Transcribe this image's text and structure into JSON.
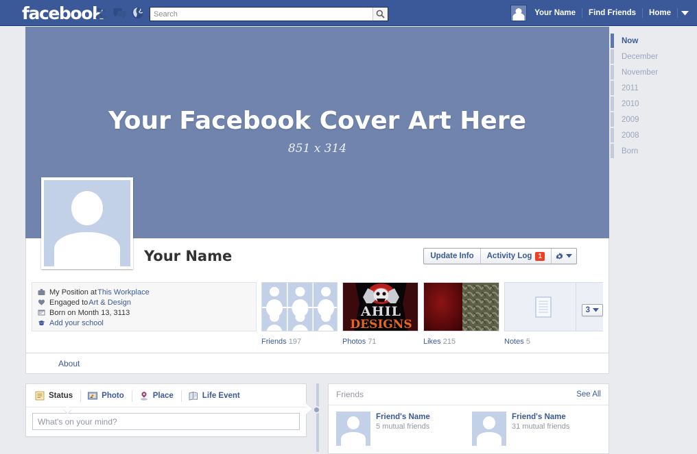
{
  "topbar": {
    "logo": "facebook",
    "icons": [
      {
        "name": "friend-requests-icon"
      },
      {
        "name": "messages-icon"
      },
      {
        "name": "notifications-globe-icon"
      }
    ],
    "search": {
      "placeholder": "Search",
      "value": "",
      "button_icon": "search-icon"
    },
    "right_links": [
      {
        "label": "Your Name",
        "name": "profile-link"
      },
      {
        "label": "Find Friends",
        "name": "find-friends-link"
      },
      {
        "label": "Home",
        "name": "home-link"
      }
    ],
    "caret_icon": "chevron-down-icon"
  },
  "rail": {
    "items": [
      {
        "label": "Now",
        "active": true
      },
      {
        "label": "December",
        "active": false
      },
      {
        "label": "November",
        "active": false
      },
      {
        "label": "2011",
        "active": false
      },
      {
        "label": "2010",
        "active": false
      },
      {
        "label": "2009",
        "active": false
      },
      {
        "label": "2008",
        "active": false
      },
      {
        "label": "Born",
        "active": false
      }
    ]
  },
  "cover": {
    "title": "Your Facebook Cover Art Here",
    "subtitle": "851 x 314",
    "color": "#7084ad"
  },
  "profile": {
    "name": "Your Name",
    "avatar_icon": "default-avatar-icon"
  },
  "actions": {
    "update_info": "Update Info",
    "activity_log": "Activity Log",
    "activity_badge": "1",
    "gear_icon": "gear-icon",
    "caret_icon": "chevron-down-icon"
  },
  "info": {
    "rows": [
      {
        "icon": "briefcase-icon",
        "text": "My Position at ",
        "link": "This Workplace"
      },
      {
        "icon": "heart-icon",
        "text": "Engaged to ",
        "link": "Art & Design"
      },
      {
        "icon": "calendar-icon",
        "text": "Born on Month   13, 3113",
        "link": ""
      },
      {
        "icon": "graduation-cap-icon",
        "text": "",
        "link": "Add your school"
      }
    ],
    "about_tab": "About"
  },
  "tiles": [
    {
      "label": "Friends",
      "count": "197",
      "kind": "friends"
    },
    {
      "label": "Photos",
      "count": "71",
      "kind": "photo-logo"
    },
    {
      "label": "Likes",
      "count": "215",
      "kind": "likes"
    },
    {
      "label": "Notes",
      "count": "5",
      "kind": "note"
    }
  ],
  "pager": {
    "value": "3",
    "caret_icon": "chevron-down-icon"
  },
  "composer": {
    "tabs": [
      {
        "label": "Status",
        "icon": "status-note-icon",
        "active": true
      },
      {
        "label": "Photo",
        "icon": "photo-icon",
        "active": false
      },
      {
        "label": "Place",
        "icon": "place-pin-icon",
        "active": false
      },
      {
        "label": "Life Event",
        "icon": "life-event-book-icon",
        "active": false
      }
    ],
    "placeholder": "What's on your mind?"
  },
  "friends_box": {
    "title": "Friends",
    "see_all": "See All",
    "items": [
      {
        "name": "Friend's Name",
        "mutual": "5 mutual friends"
      },
      {
        "name": "Friend's Name",
        "mutual": "31 mutual friends"
      }
    ]
  }
}
